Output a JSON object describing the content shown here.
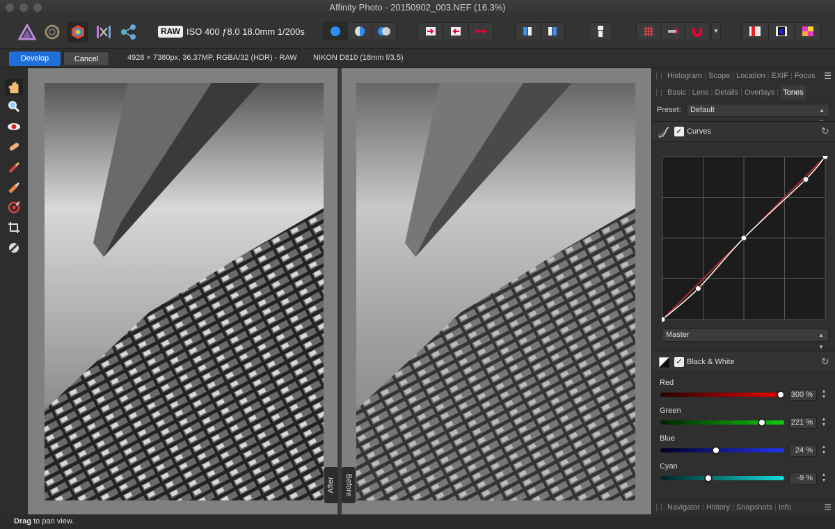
{
  "window": {
    "title": "Affinity Photo - 20150902_003.NEF (16.3%)"
  },
  "toolbar": {
    "raw_badge": "RAW",
    "exif_summary": "ISO 400 ƒ8.0 18.0mm 1/200s",
    "more_arrow": "▼"
  },
  "context": {
    "develop_label": "Develop",
    "cancel_label": "Cancel",
    "image_info": "4928 × 7380px, 36.37MP, RGBA/32 (HDR) - RAW",
    "camera_info": "NIKON D810 (18mm f/3.5)"
  },
  "canvas": {
    "after_label": "After",
    "before_label": "Before"
  },
  "panel": {
    "top_tabs": [
      "Histogram",
      "Scope",
      "Location",
      "EXIF",
      "Focus"
    ],
    "mid_tabs": [
      "Basic",
      "Lens",
      "Details",
      "Overlays",
      "Tones"
    ],
    "active_tab": "Tones",
    "preset_label": "Preset:",
    "preset_value": "Default",
    "curves": {
      "label": "Curves",
      "channel": "Master",
      "points": [
        [
          0,
          0
        ],
        [
          0.22,
          0.19
        ],
        [
          0.5,
          0.5
        ],
        [
          0.88,
          0.86
        ],
        [
          1,
          1
        ]
      ]
    },
    "bw": {
      "label": "Black & White",
      "sliders": [
        {
          "label": "Red",
          "value": "300 %",
          "level": 0.97,
          "gradient": "linear-gradient(90deg,#200,#e00)"
        },
        {
          "label": "Green",
          "value": "221 %",
          "level": 0.82,
          "gradient": "linear-gradient(90deg,#020,#1c1)"
        },
        {
          "label": "Blue",
          "value": "24 %",
          "level": 0.45,
          "gradient": "linear-gradient(90deg,#002,#23e)"
        },
        {
          "label": "Cyan",
          "value": "-9 %",
          "level": 0.39,
          "gradient": "linear-gradient(90deg,#022,#1dd)"
        }
      ]
    },
    "bottom_tabs": [
      "Navigator",
      "History",
      "Snapshots",
      "Info"
    ]
  },
  "status": {
    "bold": "Drag",
    "rest": " to pan view."
  },
  "colors": {
    "accent": "#1e6fd9",
    "curve_line": "#e03030"
  }
}
